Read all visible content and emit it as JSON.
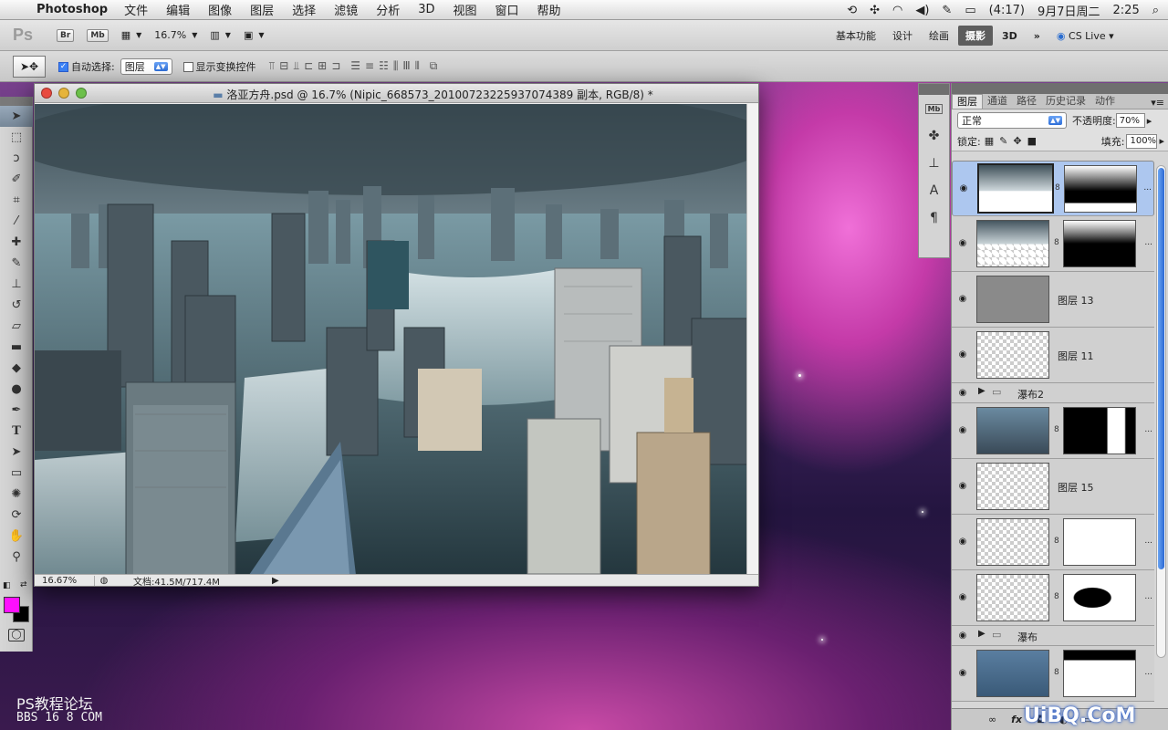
{
  "menubar": {
    "app_name": "Photoshop",
    "menus": [
      "文件",
      "编辑",
      "图像",
      "图层",
      "选择",
      "滤镜",
      "分析",
      "3D",
      "视图",
      "窗口",
      "帮助"
    ],
    "battery": "(4:17)",
    "date": "9月7日周二",
    "time": "2:25"
  },
  "appbar": {
    "logo": "Ps",
    "bridge": "Br",
    "minibridge": "Mb",
    "zoom": "16.7%",
    "workspaces": [
      "基本功能",
      "设计",
      "绘画",
      "摄影",
      "3D"
    ],
    "active_workspace": "摄影",
    "more": "»",
    "cslive": "CS Live"
  },
  "options": {
    "auto_select_label": "自动选择:",
    "auto_select_value": "图层",
    "show_transform_label": "显示变换控件"
  },
  "document": {
    "title": "洛亚方舟.psd @ 16.7% (Nipic_668573_20100723225937074389 副本, RGB/8) *",
    "zoom": "16.67%",
    "doc_size": "文档:41.5M/717.4M"
  },
  "layers_panel": {
    "tabs": [
      "图层",
      "通道",
      "路径",
      "历史记录",
      "动作"
    ],
    "active_tab": "图层",
    "blend_mode": "正常",
    "opacity_label": "不透明度:",
    "opacity": "70%",
    "lock_label": "锁定:",
    "fill_label": "填充:",
    "fill": "100%",
    "layers": [
      {
        "name": "",
        "type": "masked",
        "selected": true
      },
      {
        "name": "",
        "type": "masked",
        "selected": false
      },
      {
        "name": "图层 13",
        "type": "layer",
        "selected": false
      },
      {
        "name": "图层 11",
        "type": "layer",
        "selected": false
      },
      {
        "name": "瀑布2",
        "type": "group",
        "selected": false
      },
      {
        "name": "",
        "type": "masked",
        "selected": false
      },
      {
        "name": "图层 15",
        "type": "layer",
        "selected": false
      },
      {
        "name": "",
        "type": "masked",
        "selected": false
      },
      {
        "name": "",
        "type": "masked",
        "selected": false
      },
      {
        "name": "瀑布",
        "type": "group",
        "selected": false
      },
      {
        "name": "",
        "type": "masked",
        "selected": false
      }
    ],
    "footer": "fx"
  },
  "watermarks": {
    "forum": "PS教程论坛",
    "bbs": "BBS 16 8 COM",
    "site": "UiBQ.CoM"
  },
  "colors": {
    "foreground": "#ff10ff",
    "background": "#000000",
    "selected_layer": "#adc7ef"
  }
}
